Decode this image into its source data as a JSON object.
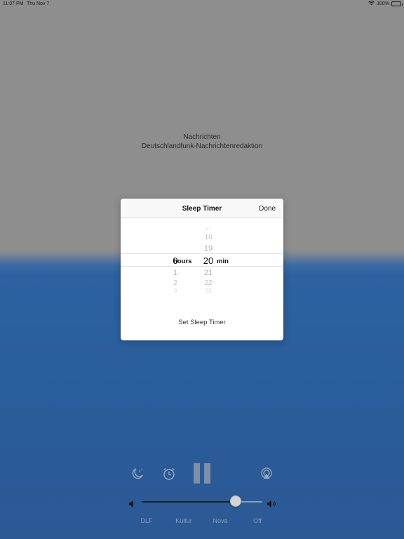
{
  "status_bar": {
    "time": "11:07 PM",
    "date": "Thu Nov 7",
    "battery": "100%",
    "icons": [
      "wifi-icon",
      "battery-icon"
    ]
  },
  "now_playing": {
    "title": "Nachrichten",
    "subtitle": "Deutschlandfunk-Nachrichtenredaktion"
  },
  "sleep_timer": {
    "title": "Sleep Timer",
    "done_label": "Done",
    "hours": {
      "unit_label": "hours",
      "selected": "0",
      "values_above": [],
      "values_below": [
        "1",
        "2",
        "3"
      ]
    },
    "minutes": {
      "unit_label": "min",
      "selected": "20",
      "values_above": [
        "17",
        "18",
        "19"
      ],
      "values_below": [
        "21",
        "22",
        "23"
      ]
    },
    "set_button_label": "Set Sleep Timer"
  },
  "controls": {
    "icons": [
      "sleep-timer-icon",
      "alarm-clock-icon",
      "pause-icon",
      "airplay-icon"
    ],
    "pause_color": "#7f8fa6"
  },
  "volume": {
    "level": 0.78,
    "icons": [
      "volume-low-icon",
      "volume-high-icon"
    ]
  },
  "stations": {
    "items": [
      "DLF",
      "Kultur",
      "Nova",
      "Off"
    ]
  },
  "colors": {
    "top_background": "#8e8e8e",
    "bottom_background": "#2a5c9a",
    "station_label": "#8b9db6"
  }
}
